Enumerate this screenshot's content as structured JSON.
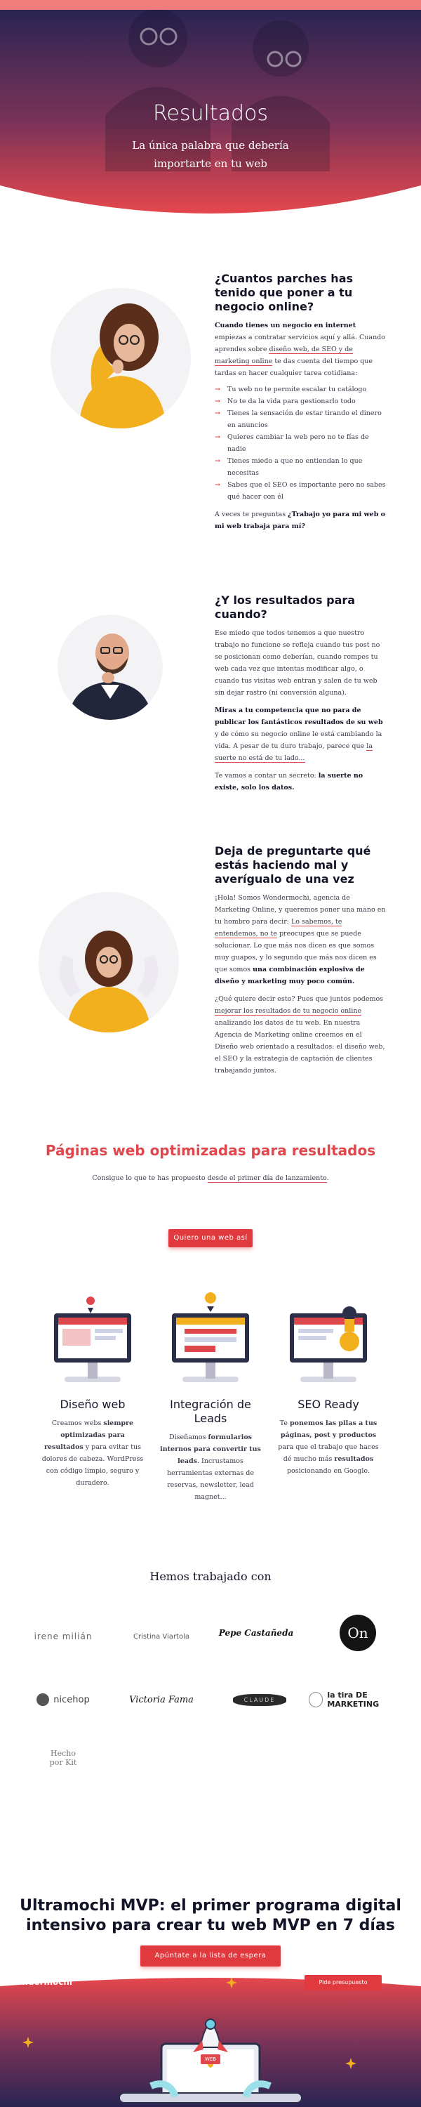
{
  "hero": {
    "title": "Resultados",
    "subtitle": "La única palabra que debería importarte en tu web"
  },
  "section1": {
    "heading": "¿Cuantos parches has tenido que poner a tu negocio online?",
    "p1_bold": "Cuando tienes un negocio en internet",
    "p1_a": " empiezas a contratar servicios aquí y allá. Cuando aprendes sobre ",
    "p1_link": "diseño web, de SEO y de marketing online",
    "p1_b": " te das cuenta del tiempo que tardas en hacer cualquier tarea cotidiana:",
    "items": [
      "Tu web no te permite escalar tu catálogo",
      "No te da la vida para gestionarlo todo",
      "Tienes la sensación de estar tirando el dinero en anuncios",
      "Quieres cambiar la web pero no te fías de nadie",
      "Tienes miedo a que no entiendan lo que necesitas",
      "Sabes que el SEO es importante pero no sabes qué hacer con él"
    ],
    "p2_a": "A veces te preguntas ",
    "p2_bold": "¿Trabajo yo para mi web o mi web trabaja para mí?"
  },
  "section2": {
    "heading": "¿Y los resultados para cuando?",
    "p1": "Ese miedo que todos tenemos a que nuestro trabajo no funcione se refleja cuando tus post no se posicionan como deberían, cuando rompes tu web cada vez que intentas modificar algo, o cuando tus visitas web entran y salen de tu web sin dejar rastro (ni conversión alguna).",
    "p2_bold": "Miras a tu competencia que no para de publicar los fantásticos resultados de su web",
    "p2_a": " y de cómo su negocio online le está cambiando la vida. A pesar de tu duro trabajo, parece que ",
    "p2_link": "la suerte no está de tu lado...",
    "p3_a": "Te vamos a contar un secreto: ",
    "p3_bold": "la suerte no existe, solo los datos."
  },
  "section3": {
    "heading": "Deja de preguntarte qué estás haciendo mal y averígualo de una vez",
    "p1_a": "¡Hola! Somos Wondermochi, agencia de Marketing Online, y queremos poner una mano en tu hombro para decir: ",
    "p1_link": "Lo sabemos, te entendemos, no te",
    "p1_b": " preocupes que se puede solucionar. Lo que más nos dicen es que somos muy guapos, y lo segundo que más nos dicen es que somos ",
    "p1_bold": "una combinación explosiva de diseño y marketing muy poco común.",
    "p2_a": "¿Qué quiere decir esto? Pues que juntos podemos ",
    "p2_link": "mejorar los resultados de tu negocio online",
    "p2_b": " analizando los datos de tu web. En nuestra Agencia de Marketing online creemos en el Diseño web orientado a resultados: el diseño web, el SEO y la estrategia de captación de clientes trabajando juntos."
  },
  "paginas": {
    "title": "Páginas web optimizadas para resultados",
    "subtitle_a": "Consigue lo que te has propuesto ",
    "subtitle_link": "desde el primer día de lanzamiento",
    "subtitle_b": ".",
    "cta": "Quiero una web así"
  },
  "features": [
    {
      "title": "Diseño web",
      "a": "Creamos webs ",
      "bold1": "siempre optimizadas para resultados",
      "b": " y para evitar tus dolores de cabeza. WordPress con código limpio, seguro y duradero."
    },
    {
      "title": "Integración de Leads",
      "a": "Diseñamos ",
      "bold1": "formularios internos para convertir tus leads",
      "b": ". Incrustamos herramientas externas de reservas, newsletter, lead magnet..."
    },
    {
      "title": "SEO Ready",
      "a": "Te ",
      "bold1": "ponemos las pilas a tus páginas, post y productos",
      "b": " para que el trabajo que haces dé mucho más ",
      "bold2": "resultados",
      "c": " posicionando en Google."
    }
  ],
  "clients": {
    "title": "Hemos trabajado con",
    "logos": [
      "irene milián",
      "Cristina Viartola",
      "Pepe Castañeda",
      "On",
      "nicehop",
      "Victoria Fama",
      "CLAUDE",
      "la tira DE MARKETING",
      "Hecho por Kit"
    ]
  },
  "mvp": {
    "title": "Ultramochi MVP: el primer programa digital intensivo para crear tu web MVP en 7 días",
    "cta": "Apúntate a la lista de espera"
  },
  "footer": {
    "brand": "wondermochi",
    "cta": "Pide presupuesto",
    "laptop_label": "WEB"
  }
}
